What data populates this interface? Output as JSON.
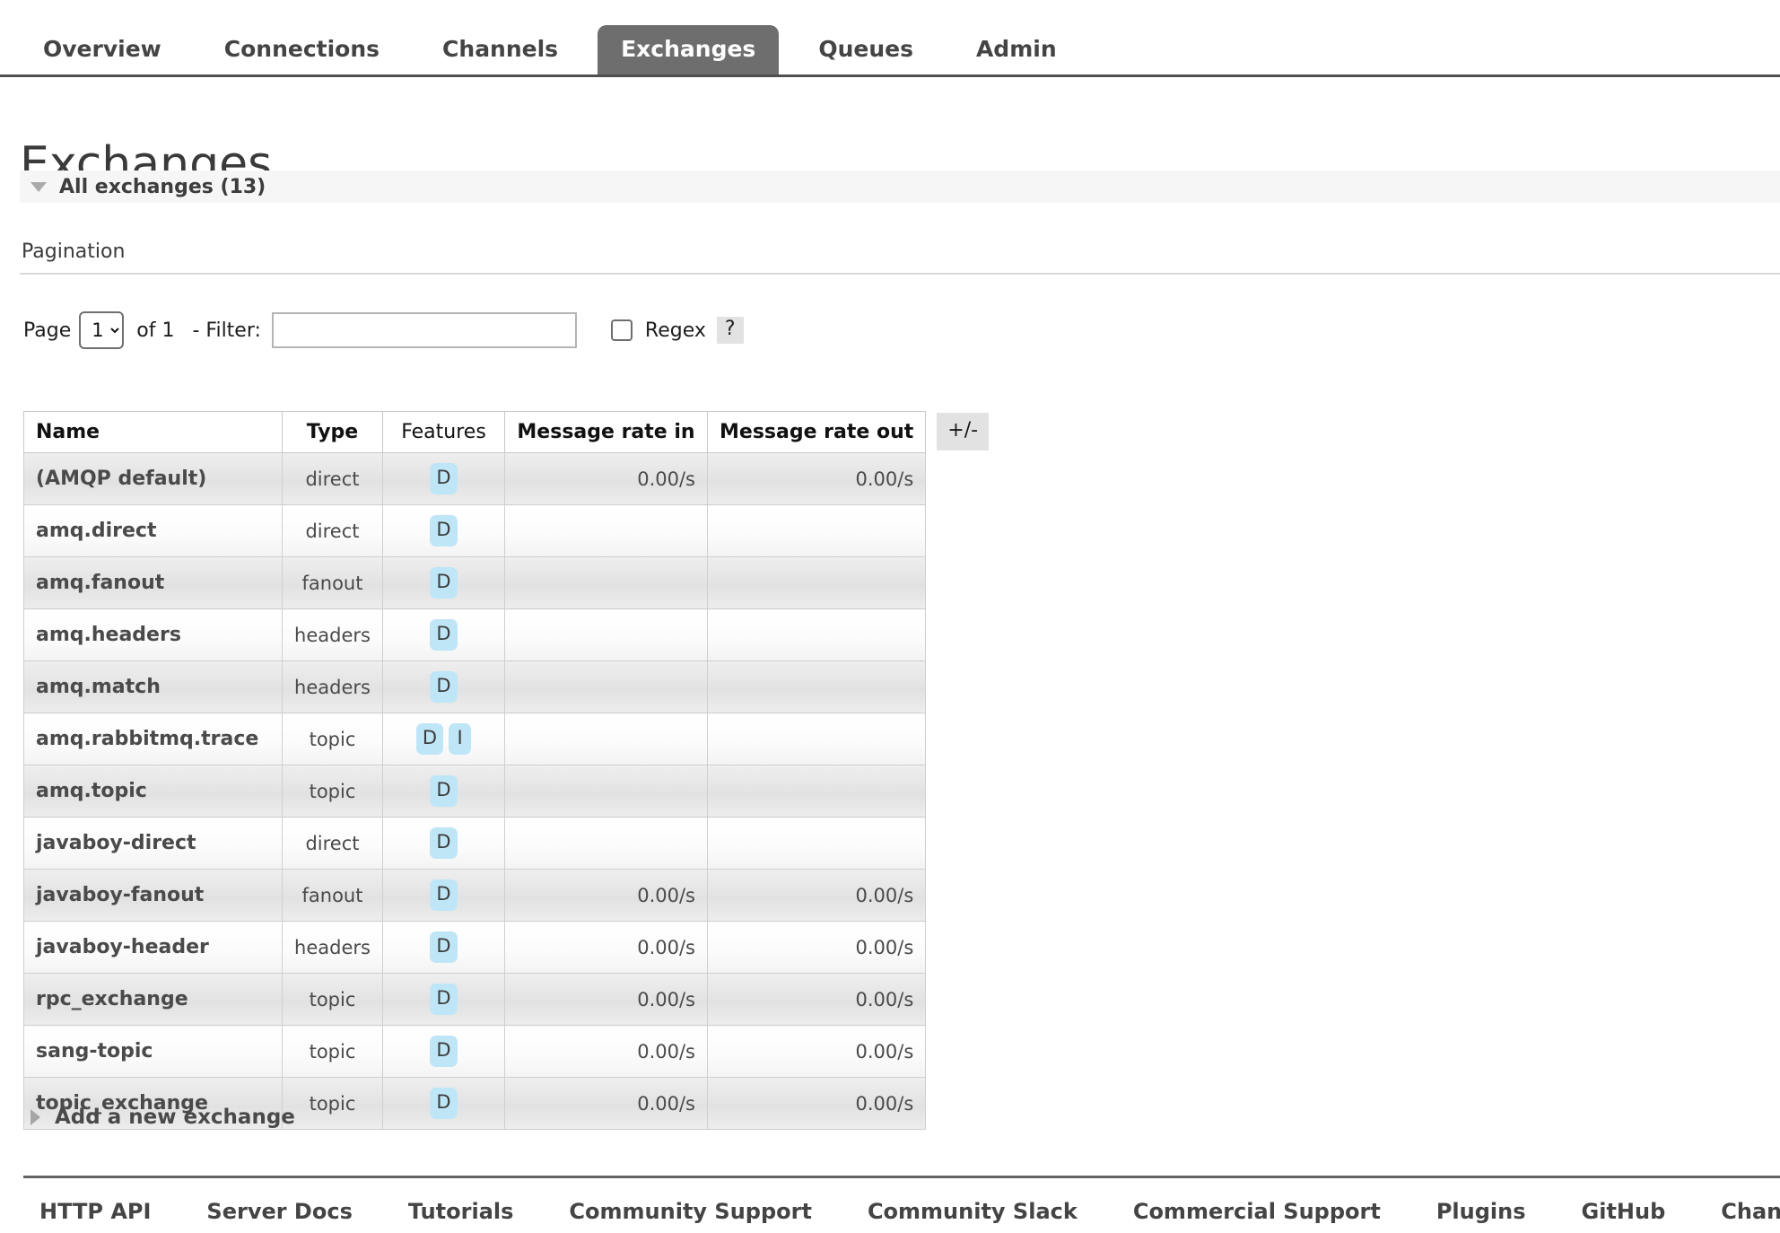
{
  "nav": {
    "items": [
      {
        "label": "Overview",
        "selected": false
      },
      {
        "label": "Connections",
        "selected": false
      },
      {
        "label": "Channels",
        "selected": false
      },
      {
        "label": "Exchanges",
        "selected": true
      },
      {
        "label": "Queues",
        "selected": false
      },
      {
        "label": "Admin",
        "selected": false
      }
    ]
  },
  "page": {
    "title": "Exchanges",
    "section_header": "All exchanges (13)"
  },
  "pagination": {
    "label": "Pagination",
    "page_word": "Page",
    "page_value": "1",
    "page_options": [
      "1"
    ],
    "of_total": "of 1",
    "separator": "-",
    "filter_label": "Filter:",
    "filter_value": "",
    "filter_placeholder": "",
    "regex_label": "Regex",
    "regex_checked": false,
    "help_label": "?"
  },
  "table": {
    "columns": [
      {
        "key": "name",
        "label": "Name",
        "sortable": true
      },
      {
        "key": "type",
        "label": "Type",
        "sortable": true
      },
      {
        "key": "features",
        "label": "Features",
        "sortable": false
      },
      {
        "key": "rate_in",
        "label": "Message rate in",
        "sortable": true
      },
      {
        "key": "rate_out",
        "label": "Message rate out",
        "sortable": true
      }
    ],
    "toggle_columns_label": "+/-",
    "rows": [
      {
        "name": "(AMQP default)",
        "type": "direct",
        "features": [
          "D"
        ],
        "rate_in": "0.00/s",
        "rate_out": "0.00/s"
      },
      {
        "name": "amq.direct",
        "type": "direct",
        "features": [
          "D"
        ],
        "rate_in": "",
        "rate_out": ""
      },
      {
        "name": "amq.fanout",
        "type": "fanout",
        "features": [
          "D"
        ],
        "rate_in": "",
        "rate_out": ""
      },
      {
        "name": "amq.headers",
        "type": "headers",
        "features": [
          "D"
        ],
        "rate_in": "",
        "rate_out": ""
      },
      {
        "name": "amq.match",
        "type": "headers",
        "features": [
          "D"
        ],
        "rate_in": "",
        "rate_out": ""
      },
      {
        "name": "amq.rabbitmq.trace",
        "type": "topic",
        "features": [
          "D",
          "I"
        ],
        "rate_in": "",
        "rate_out": ""
      },
      {
        "name": "amq.topic",
        "type": "topic",
        "features": [
          "D"
        ],
        "rate_in": "",
        "rate_out": ""
      },
      {
        "name": "javaboy-direct",
        "type": "direct",
        "features": [
          "D"
        ],
        "rate_in": "",
        "rate_out": ""
      },
      {
        "name": "javaboy-fanout",
        "type": "fanout",
        "features": [
          "D"
        ],
        "rate_in": "0.00/s",
        "rate_out": "0.00/s"
      },
      {
        "name": "javaboy-header",
        "type": "headers",
        "features": [
          "D"
        ],
        "rate_in": "0.00/s",
        "rate_out": "0.00/s"
      },
      {
        "name": "rpc_exchange",
        "type": "topic",
        "features": [
          "D"
        ],
        "rate_in": "0.00/s",
        "rate_out": "0.00/s"
      },
      {
        "name": "sang-topic",
        "type": "topic",
        "features": [
          "D"
        ],
        "rate_in": "0.00/s",
        "rate_out": "0.00/s"
      },
      {
        "name": "topic_exchange",
        "type": "topic",
        "features": [
          "D"
        ],
        "rate_in": "0.00/s",
        "rate_out": "0.00/s"
      }
    ]
  },
  "add_exchange": {
    "label": "Add a new exchange"
  },
  "footer": {
    "links": [
      "HTTP API",
      "Server Docs",
      "Tutorials",
      "Community Support",
      "Community Slack",
      "Commercial Support",
      "Plugins",
      "GitHub",
      "Changelog"
    ]
  },
  "colors": {
    "tab_selected_bg": "#6e6e6e",
    "tab_selected_text": "#ffffff",
    "nav_border": "#4f4f4f",
    "feature_badge_bg": "#bfe6f7",
    "section_header_bg": "#f6f6f6",
    "row_stripe_bg": "#e8e8e8",
    "help_bg": "#e2e2e2"
  }
}
